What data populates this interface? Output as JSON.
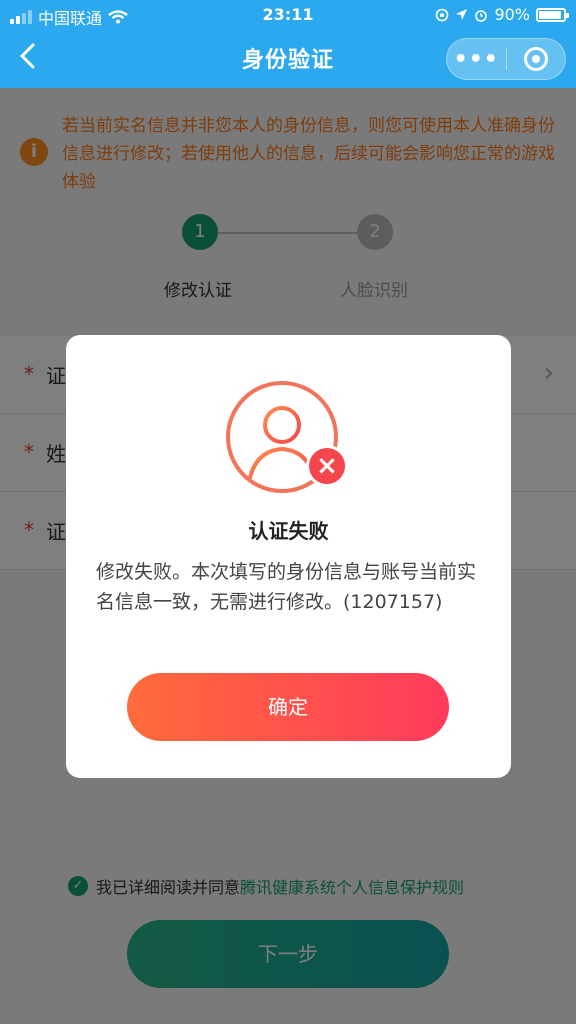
{
  "status_bar": {
    "carrier": "中国联通",
    "time": "23:11",
    "battery": "90%"
  },
  "nav": {
    "title": "身份验证",
    "more_label": "•••"
  },
  "notice": {
    "icon_text": "i",
    "text": "若当前实名信息并非您本人的身份信息，则您可使用本人准确身份信息进行修改；若使用他人的信息，后续可能会影响您正常的游戏体验"
  },
  "steps": [
    {
      "num": "1",
      "label": "修改认证"
    },
    {
      "num": "2",
      "label": "人脸识别"
    }
  ],
  "form": {
    "rows": [
      {
        "required": "*",
        "label": "证"
      },
      {
        "required": "*",
        "label": "姓"
      },
      {
        "required": "*",
        "label": "证"
      }
    ]
  },
  "agreement": {
    "prefix": "我已详细阅读并同意",
    "link": "腾讯健康系统个人信息保护规则"
  },
  "next_button": "下一步",
  "dialog": {
    "title": "认证失败",
    "message": "修改失败。本次填写的身份信息与账号当前实名信息一致，无需进行修改。(1207157)",
    "ok_button": "确定"
  },
  "colors": {
    "nav_bg": "#2ba8ee",
    "accent_green": "#15a06e",
    "error_red": "#f5464d",
    "notice_orange": "#ff7a1a"
  },
  "icons": [
    "back-icon",
    "more-icon",
    "close-mini-program-icon",
    "info-icon",
    "avatar-icon",
    "error-x-icon",
    "check-icon",
    "chevron-right-icon"
  ]
}
